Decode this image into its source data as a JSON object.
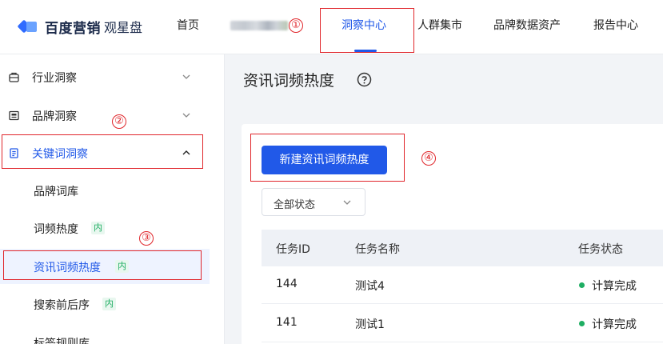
{
  "header": {
    "logo_brand": "百度营销",
    "logo_product": "观星盘",
    "nav": [
      {
        "label": "首页"
      },
      {
        "label": "洞察中心",
        "active": true
      },
      {
        "label": "人群集市"
      },
      {
        "label": "品牌数据资产"
      },
      {
        "label": "报告中心"
      }
    ]
  },
  "annotations": [
    "①",
    "②",
    "③",
    "④"
  ],
  "sidebar": {
    "groups": [
      {
        "label": "行业洞察",
        "icon": "industry-icon",
        "expanded": false
      },
      {
        "label": "品牌洞察",
        "icon": "brand-icon",
        "expanded": false
      },
      {
        "label": "关键词洞察",
        "icon": "keyword-icon",
        "expanded": true,
        "active": true
      }
    ],
    "items": [
      {
        "label": "品牌词库"
      },
      {
        "label": "词频热度",
        "tag": "内"
      },
      {
        "label": "资讯词频热度",
        "tag": "内",
        "selected": true
      },
      {
        "label": "搜索前后序",
        "tag": "内"
      },
      {
        "label": "标签规则库"
      }
    ]
  },
  "main": {
    "title": "资讯词频热度",
    "create_button": "新建资讯词频热度",
    "status_filter": "全部状态",
    "table": {
      "columns": [
        "任务ID",
        "任务名称",
        "任务状态"
      ],
      "rows": [
        {
          "id": "144",
          "name": "测试4",
          "status": "计算完成"
        },
        {
          "id": "141",
          "name": "测试1",
          "status": "计算完成"
        }
      ]
    }
  },
  "colors": {
    "primary": "#2159e8",
    "annotation": "#e0262b",
    "status_done": "#1fae63",
    "tag_text": "#1fae63"
  }
}
